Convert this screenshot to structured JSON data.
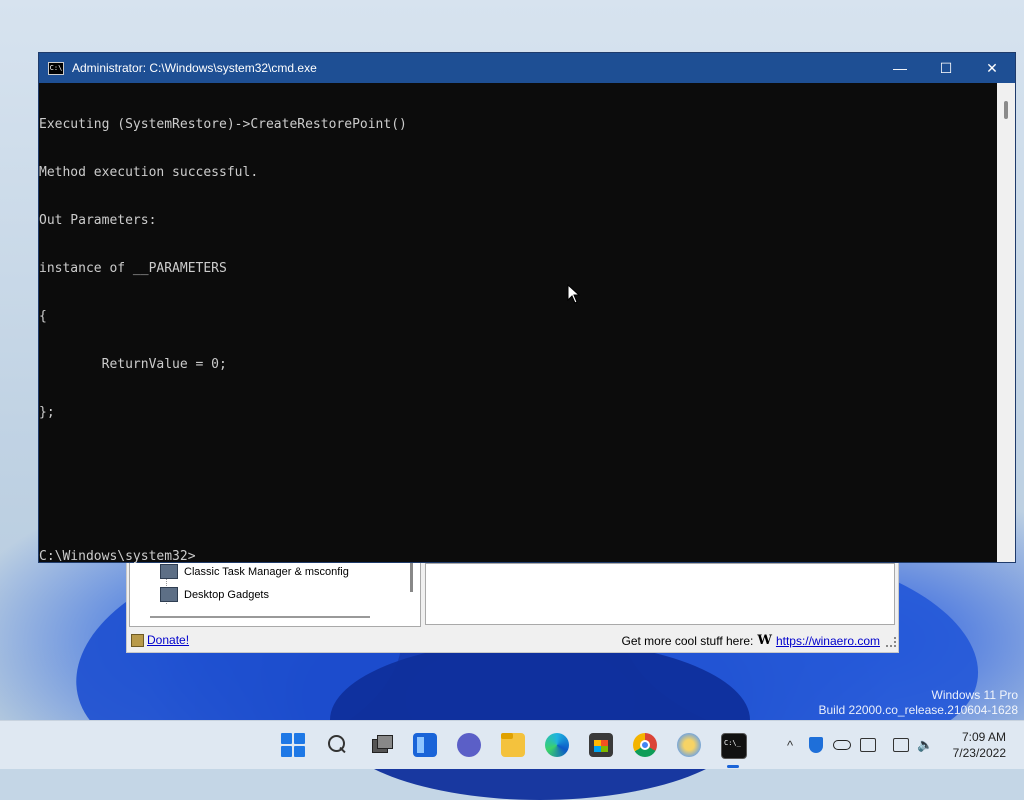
{
  "cmd_window": {
    "title": "Administrator: C:\\Windows\\system32\\cmd.exe",
    "icon": "cmd-app-icon",
    "controls": {
      "minimize": "—",
      "maximize": "☐",
      "close": "✕"
    },
    "console_lines": [
      "Executing (SystemRestore)->CreateRestorePoint()",
      "Method execution successful.",
      "Out Parameters:",
      "instance of __PARAMETERS",
      "{",
      "        ReturnValue = 0;",
      "};",
      "",
      "",
      "C:\\Windows\\system32>"
    ]
  },
  "winaero_window": {
    "tree_items": [
      "Classic Task Manager & msconfig",
      "Desktop Gadgets"
    ],
    "status_left_link": "Donate!",
    "status_right_text": "Get more cool stuff here:",
    "status_right_logo": "W",
    "status_right_link": "https://winaero.com"
  },
  "watermark": {
    "line1": "Windows 11 Pro",
    "line2": "Build 22000.co_release.210604-1628"
  },
  "taskbar": {
    "apps": [
      "start-icon",
      "search-icon",
      "task-view-icon",
      "widgets-icon",
      "chat-icon",
      "file-explorer-icon",
      "edge-icon",
      "store-icon",
      "chrome-icon",
      "winaero-tweaker-icon",
      "cmd-icon"
    ],
    "tray": {
      "chevron": "^",
      "icons": [
        "security-icon",
        "onedrive-icon",
        "keyboard-icon",
        "network-icon",
        "volume-icon"
      ]
    },
    "clock": {
      "time": "7:09 AM",
      "date": "7/23/2022"
    }
  },
  "colors": {
    "titlebar": "#1e4f94",
    "console_bg": "#0c0c0c",
    "console_text": "#cccccc",
    "link": "#0000cc"
  }
}
